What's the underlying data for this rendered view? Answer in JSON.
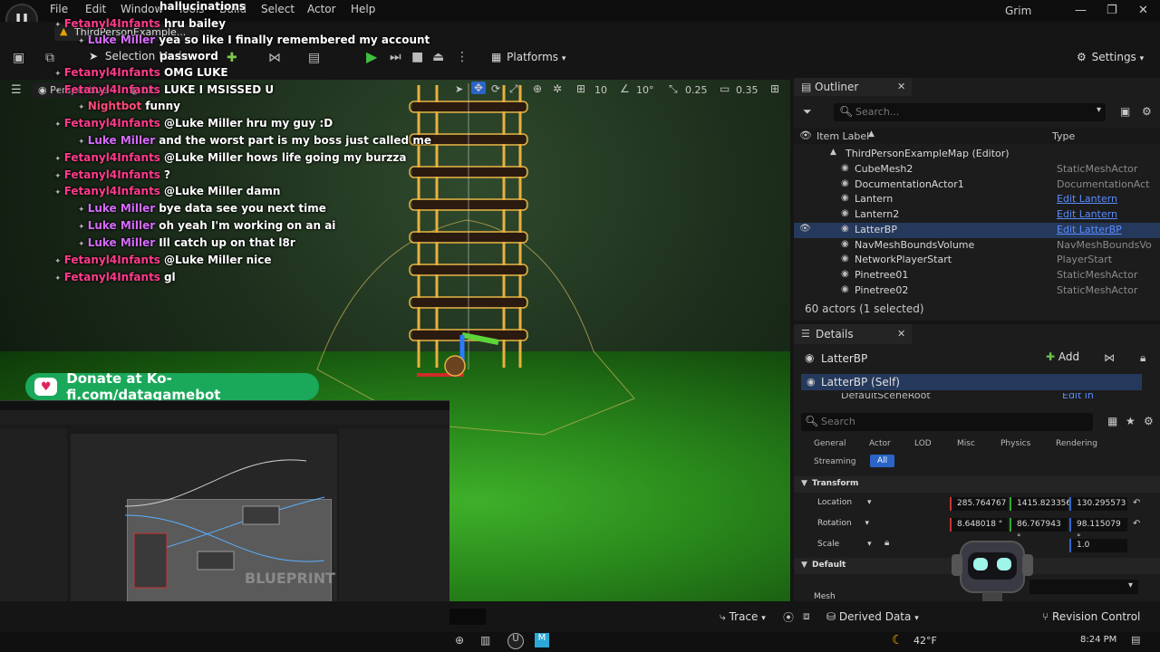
{
  "menu": {
    "items": [
      "File",
      "Edit",
      "Window",
      "Tools",
      "Build",
      "Select",
      "Actor",
      "Help"
    ],
    "project": "Grim",
    "map_tab": "ThirdPersonExample...",
    "logo": "U"
  },
  "toolbar": {
    "selection_mode": "Selection Mode",
    "platforms": "Platforms",
    "settings": "Settings"
  },
  "viewport": {
    "perspective": "Perspective",
    "lit": "Lit",
    "grid_snap": "10",
    "rot_snap": "10°",
    "scale_snap": "0.25",
    "cam_speed": "0.35"
  },
  "chat": [
    {
      "name": "",
      "msg": "hallucinations",
      "cls": "purple",
      "indent": false
    },
    {
      "name": "Fetanyl4Infants",
      "msg": "hru bailey",
      "cls": "pink",
      "indent": false
    },
    {
      "name": "Luke Miller",
      "msg": "yea so like I finally remembered my account",
      "cls": "purple",
      "indent": true
    },
    {
      "name": "",
      "msg": "password",
      "cls": "purple",
      "indent": true
    },
    {
      "name": "Fetanyl4Infants",
      "msg": "OMG LUKE",
      "cls": "pink",
      "indent": false
    },
    {
      "name": "Fetanyl4Infants",
      "msg": "LUKE I MSISSED U",
      "cls": "pink",
      "indent": false
    },
    {
      "name": "Nightbot",
      "msg": "funny",
      "cls": "mod",
      "indent": true
    },
    {
      "name": "Fetanyl4Infants",
      "msg": "@Luke Miller hru my guy :D",
      "cls": "pink",
      "indent": false
    },
    {
      "name": "Luke Miller",
      "msg": "and the worst part is my boss just called me",
      "cls": "purple",
      "indent": true
    },
    {
      "name": "Fetanyl4Infants",
      "msg": "@Luke Miller hows life going my burzza",
      "cls": "pink",
      "indent": false
    },
    {
      "name": "Fetanyl4Infants",
      "msg": "?",
      "cls": "pink",
      "indent": false
    },
    {
      "name": "Fetanyl4Infants",
      "msg": "@Luke Miller damn",
      "cls": "pink",
      "indent": false
    },
    {
      "name": "Luke Miller",
      "msg": "bye data see you next time",
      "cls": "purple",
      "indent": true
    },
    {
      "name": "Luke Miller",
      "msg": "oh yeah I'm working on an ai",
      "cls": "purple",
      "indent": true
    },
    {
      "name": "Luke Miller",
      "msg": "Ill catch up on that l8r",
      "cls": "purple",
      "indent": true
    },
    {
      "name": "Fetanyl4Infants",
      "msg": "@Luke Miller nice",
      "cls": "pink",
      "indent": false
    },
    {
      "name": "Fetanyl4Infants",
      "msg": "gl",
      "cls": "pink",
      "indent": false
    }
  ],
  "donate": "Donate at Ko-fi.com/datagamebot",
  "blueprint_window": {
    "watermark": "BLUEPRINT"
  },
  "outliner": {
    "title": "Outliner",
    "search_placeholder": "Search...",
    "col_label": "Item Label",
    "col_type": "Type",
    "root": "ThirdPersonExampleMap (Editor)",
    "rows": [
      {
        "label": "CubeMesh2",
        "type": "StaticMeshActor",
        "link": false
      },
      {
        "label": "DocumentationActor1",
        "type": "DocumentationAct",
        "link": false
      },
      {
        "label": "Lantern",
        "type": "Edit Lantern",
        "link": true
      },
      {
        "label": "Lantern2",
        "type": "Edit Lantern",
        "link": true
      },
      {
        "label": "LatterBP",
        "type": "Edit LatterBP",
        "link": true
      },
      {
        "label": "NavMeshBoundsVolume",
        "type": "NavMeshBoundsVo",
        "link": false
      },
      {
        "label": "NetworkPlayerStart",
        "type": "PlayerStart",
        "link": false
      },
      {
        "label": "Pinetree01",
        "type": "StaticMeshActor",
        "link": false
      },
      {
        "label": "Pinetree02",
        "type": "StaticMeshActor",
        "link": false
      }
    ],
    "footer": "60 actors (1 selected)"
  },
  "details": {
    "title": "Details",
    "actor": "LatterBP",
    "add": "Add",
    "self": "LatterBP (Self)",
    "scene_root": "DefaultSceneRoot",
    "edit_bp": "Edit in Blueprint",
    "search_placeholder": "Search",
    "cats": [
      "General",
      "Actor",
      "LOD",
      "Misc",
      "Physics",
      "Rendering"
    ],
    "streaming": "Streaming",
    "all": "All",
    "transform": "Transform",
    "location": "Location",
    "rotation": "Rotation",
    "scale": "Scale",
    "loc": [
      "285.764767",
      "1415.823356",
      "130.295573"
    ],
    "rot": [
      "8.648018 °",
      "86.767943 °",
      "98.115079 °"
    ],
    "scale_z": "1.0",
    "default": "Default",
    "mesh": "Mesh"
  },
  "statusbar": {
    "trace": "Trace",
    "derived": "Derived Data",
    "revision": "Revision Control"
  },
  "taskbar": {
    "temp": "42°F",
    "time": "8:24 PM"
  }
}
